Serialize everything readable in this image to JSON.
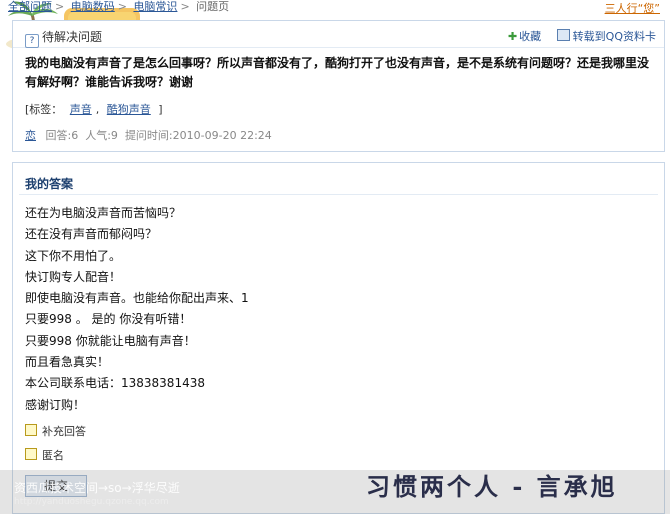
{
  "breadcrumb": {
    "items": [
      "全部问题",
      "电脑数码",
      "电脑常识"
    ],
    "current": "问题页"
  },
  "top_right_link": "三人行“您”",
  "question": {
    "status": "待解决问题",
    "actions": {
      "collect": "收藏",
      "share": "转载到QQ资料卡"
    },
    "title": "我的电脑没有声音了是怎么回事呀？所以声音都没有了，酷狗打开了也没有声音，是不是系统有问题呀？还是我哪里没有解好啊？谁能告诉我呀？谢谢",
    "tags_label": "[标签：",
    "tags": [
      "声音",
      "酷狗声音"
    ],
    "tags_close": "]",
    "meta": {
      "user": "恋",
      "answers": "回答:6",
      "views": "人气:9",
      "time": "提问时间:2010-09-20 22:24"
    }
  },
  "answer_section": {
    "title": "我的答案",
    "lines": [
      "还在为电脑没声音而苦恼吗？",
      "还在没有声音而郁闷吗？",
      "这下你不用怕了。",
      "快订购专人配音！",
      "即使电脑没有声音。也能给你配出声来、1",
      "只要998 。 是的  你没有听错！",
      "只要998  你就能让电脑有声音！",
      "而且看急真实！",
      "本公司联系电话：13838381438",
      "感谢订购！"
    ],
    "options": {
      "supplement": "补充回答",
      "anonymous": "匿名"
    },
    "submit": "提交"
  },
  "watermark": {
    "left_text": "资西瓜技术空间→so→浮华尽逝",
    "left_url": "http://yanduoshegu.qzone.qq.com",
    "right_text": "习惯两个人 - 言承旭"
  },
  "colors": {
    "link": "#2b5797",
    "border": "#c9d7e8",
    "checkbox": "#fff9c8"
  }
}
